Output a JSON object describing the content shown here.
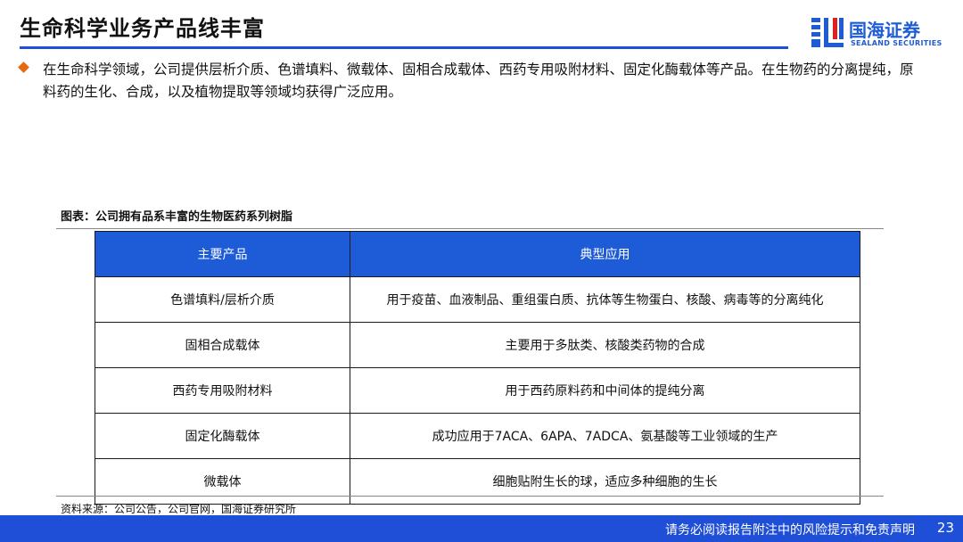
{
  "header": {
    "title": "生命科学业务产品线丰富",
    "logo_cn": "国海证券",
    "logo_en": "SEALAND SECURITIES"
  },
  "bullet": {
    "text": "在生命科学领域，公司提供层析介质、色谱填料、微载体、固相合成载体、西药专用吸附材料、固定化酶载体等产品。在生物药的分离提纯，原料药的生化、合成，以及植物提取等领域均获得广泛应用。"
  },
  "figure": {
    "title": "图表：公司拥有品系丰富的生物医药系列树脂",
    "headers": [
      "主要产品",
      "典型应用"
    ],
    "rows": [
      {
        "product": "色谱填料/层析介质",
        "application": "用于疫苗、血液制品、重组蛋白质、抗体等生物蛋白、核酸、病毒等的分离纯化"
      },
      {
        "product": "固相合成载体",
        "application": "主要用于多肽类、核酸类药物的合成"
      },
      {
        "product": "西药专用吸附材料",
        "application": "用于西药原料药和中间体的提纯分离"
      },
      {
        "product": "固定化酶载体",
        "application": "成功应用于7ACA、6APA、7ADCA、氨基酸等工业领域的生产"
      },
      {
        "product": "微载体",
        "application": "细胞贴附生长的球，适应多种细胞的生长"
      }
    ],
    "source": "资料来源：公司公告，公司官网，国海证券研究所"
  },
  "footer": {
    "disclaimer": "请务必阅读报告附注中的风险提示和免责声明",
    "page": "23"
  },
  "colors": {
    "brand_blue": "#1e5bd6",
    "bullet_orange": "#e86a10"
  }
}
